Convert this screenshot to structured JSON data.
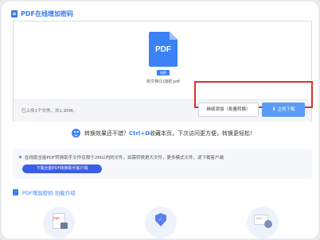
{
  "header": {
    "title": "PDF在线增加密码"
  },
  "upload": {
    "file_badge": "加密",
    "file_name": "新文档(1)加密.pdf",
    "pdf_label": "PDF",
    "status": "已上传1个文件，共1.95M。",
    "continue_label": "继续添加（批量转换）",
    "download_label": "立即下载",
    "download_icon": "⬇"
  },
  "tip": {
    "prefix": "转换效果还不错？",
    "shortcut": "Ctrl+D",
    "suffix": "收藏本页，下次访问更方便，转换更轻松!"
  },
  "notice": {
    "text": "在线版全能PDF转换助手文件仅限于2M以内的文件，如需转换更大文件，更多模式文件，请下载客户端",
    "button_label": "下载全能PDF转换助手客户端"
  },
  "features": {
    "title": "PDF增加密码 功能介绍",
    "items": [
      {
        "icon": "pdf-lock-icon",
        "label": "PDF"
      },
      {
        "icon": "shield-icon",
        "label": ""
      },
      {
        "icon": "doc-user-icon",
        "label": "DOC"
      }
    ]
  },
  "colors": {
    "accent": "#3b82f6",
    "highlight_border": "#e0302a",
    "download_btn": "#5b9bf8"
  }
}
